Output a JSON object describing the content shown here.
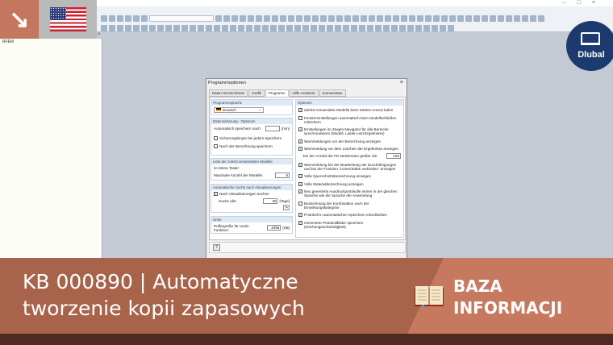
{
  "app": {
    "panel_title": "RFEM",
    "colors": {
      "accent": "#c4775e",
      "brand": "#1d3a6e"
    }
  },
  "logo": {
    "text": "Dlubal"
  },
  "dialog": {
    "title": "Programmoptionen",
    "close": "×",
    "tabs": [
      "Daten-Verzeichnisse",
      "Grafik",
      "Programm",
      "Hilfe-Assistent",
      "Kommentare"
    ],
    "active_tab": "Programm",
    "language": {
      "header": "Programmsprache",
      "value": "Deutsch"
    },
    "backup": {
      "header": "Datensicherung - Optionen",
      "autosave_label": "Automatisch speichern nach:",
      "autosave_value": "",
      "autosave_unit": "[min]",
      "backup_each_save": "Sicherungskopie bei jedem Speichern",
      "save_after_calc": "Nach der Berechnung speichern"
    },
    "recent": {
      "header": "Liste der zuletzt verwendeten Modelle",
      "menu_label": "im Menü 'Datei'",
      "max_label": "Maximale Anzahl der Modelle:",
      "max_value": "6"
    },
    "updates": {
      "header": "Automatische Suche nach Aktualisierungen",
      "check_label": "Nach Aktualisierungen suchen",
      "interval_label": "Suche alle:",
      "interval_value": "30",
      "interval_unit": "[Tage]"
    },
    "undo": {
      "header": "Undo",
      "buffer_label": "Puffergröße für Undo-Funktion:",
      "buffer_value": "4096",
      "buffer_unit": "[KB]"
    },
    "options": {
      "header": "Optionen",
      "items": [
        {
          "label": "Zuletzt verwendete Modelle beim Starten erneut laden",
          "checked": true
        },
        {
          "label": "Fenstereinstellungen automatisch beim Modellschließen mitsichern",
          "checked": false
        },
        {
          "label": "Einstellungen im Zeigen-Navigator für alle Bereiche synchronisieren (Modell, Lasten und Ergebnisse)",
          "checked": true
        },
        {
          "label": "Warnmeldungen vor der Berechnung anzeigen",
          "checked": true
        },
        {
          "label": "Warnmeldung vor dem Löschen der Ergebnisse anzeigen",
          "checked": true
        },
        {
          "label": "Warnmeldung bei der Bearbeitung der Durchdringungen und bei der Funktion \"Linien/Stäbe verbinden\" anzeigen",
          "checked": true
        },
        {
          "label": "Volle Querschnittsbezeichnung anzeigen",
          "checked": true
        },
        {
          "label": "Volle Materialbezeichnung anzeigen",
          "checked": true
        },
        {
          "label": "Neu generierte Ausdruckprotokolle immer in der gleichen Sprache wie die Sprache der Anwendung",
          "checked": true
        },
        {
          "label": "Bezeichnung der Kombination nach der Einwirkungskategorie",
          "checked": false
        },
        {
          "label": "Protokoll in automatischen Speichern einschließen",
          "checked": true
        },
        {
          "label": "Generierte Protokollbilder speichern (Zeichengeschwindigkeit)",
          "checked": true
        }
      ],
      "fe_nodes_label": "bei der Anzahl der FE-Netzknoten größer als:",
      "fe_nodes_value": "100"
    }
  },
  "banner": {
    "title_line1": "KB 000890 | Automatyczne",
    "title_line2": "tworzenie kopii zapasowych",
    "category_line1": "BAZA",
    "category_line2": "INFORMACJI"
  }
}
